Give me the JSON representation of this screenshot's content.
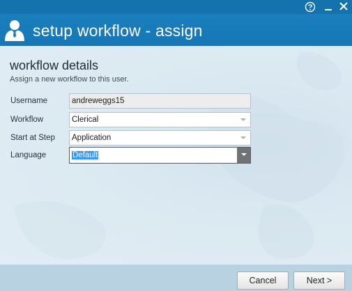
{
  "window": {
    "title": "setup workflow - assign",
    "controls": {
      "help": "?",
      "minimize": "_",
      "close": "✕"
    }
  },
  "header": {
    "icon": "user-silhouette-icon"
  },
  "section": {
    "title": "workflow details",
    "subtitle": "Assign a new workflow to this user."
  },
  "form": {
    "username_label": "Username",
    "username_value": "andreweggs15",
    "workflow_label": "Workflow",
    "workflow_value": "Clerical",
    "start_step_label": "Start at Step",
    "start_step_value": "Application",
    "language_label": "Language",
    "language_value": "Default"
  },
  "footer": {
    "cancel_label": "Cancel",
    "next_label": "Next >"
  },
  "colors": {
    "title_bar": "#1473ad",
    "header": "#1a7fbe",
    "content_bg": "#dbe9f2",
    "footer_bg": "#b9d2e2",
    "selection": "#3399ff"
  }
}
